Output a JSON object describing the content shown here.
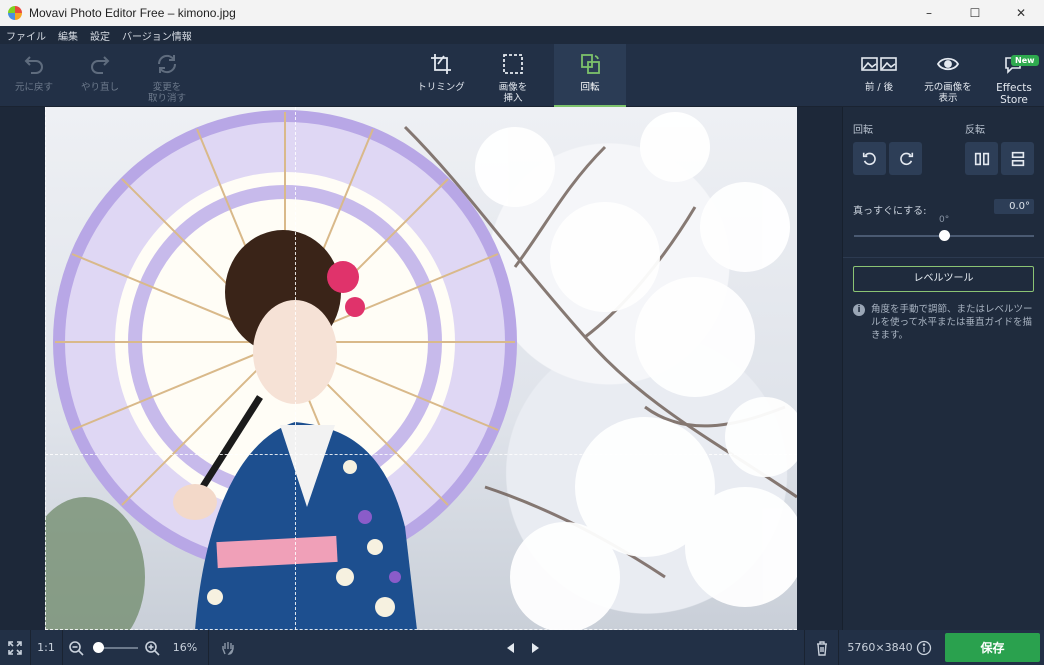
{
  "window": {
    "title": "Movavi Photo Editor Free – kimono.jpg",
    "minimize": "–",
    "maximize": "☐",
    "close": "✕"
  },
  "menu": [
    "ファイル",
    "編集",
    "設定",
    "バージョン情報"
  ],
  "toolbar": {
    "undo": "元に戻す",
    "redo": "やり直し",
    "revert_1": "変更を",
    "revert_2": "取り消す",
    "crop": "トリミング",
    "insert_1": "画像を",
    "insert_2": "挿入",
    "rotate": "回転",
    "before_after": "前 / 後",
    "show_original_1": "元の画像を",
    "show_original_2": "表示",
    "effects_1": "Effects",
    "effects_2": "Store",
    "new_badge": "New"
  },
  "panel": {
    "rotate_label": "回転",
    "flip_label": "反転",
    "straighten_label": "真っすぐにする:",
    "angle_value": "0.0°",
    "angle_scale": "0°",
    "angle_level": 0.5,
    "level_tool": "レベルツール",
    "info": "角度を手動で調節、またはレベルツールを使って水平または垂直ガイドを描きます。"
  },
  "bottom": {
    "fit_label": "1:1",
    "zoom": "16%",
    "zoom_level": 0.1,
    "dimensions": "5760×3840",
    "save": "保存"
  },
  "colors": {
    "accent_green": "#2aa14e",
    "active_underline": "#7dc26b",
    "panel_bg": "#1f2b3d",
    "toolbar_bg": "#223046"
  }
}
